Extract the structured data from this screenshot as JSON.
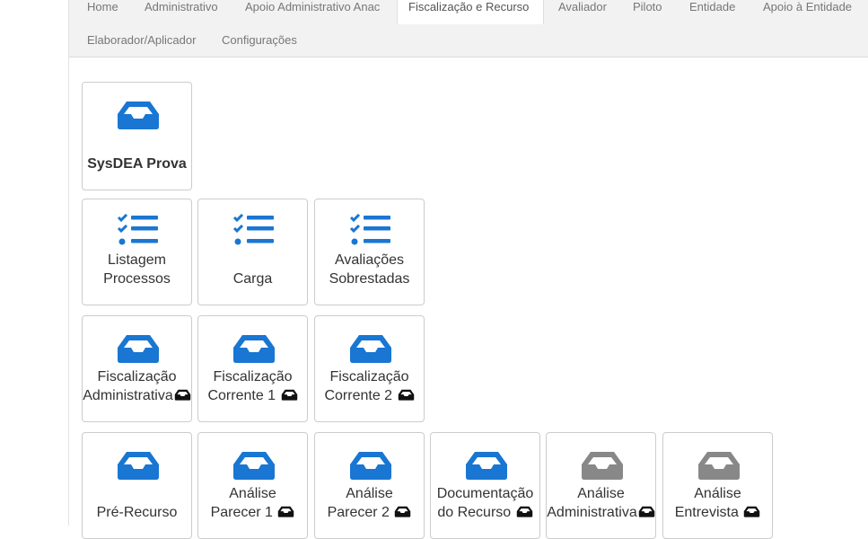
{
  "nav": {
    "items": [
      "Home",
      "Administrativo",
      "Apoio Administrativo Anac",
      "Fiscalização e Recurso",
      "Avaliador",
      "Piloto",
      "Entidade",
      "Apoio à Entidade",
      "Elaborador/Aplicador",
      "Configurações"
    ],
    "active": "Fiscalização e Recurso"
  },
  "icons": {
    "inbox": "inbox-icon",
    "list": "list-check-icon",
    "inbox_small": "inbox-small-icon"
  },
  "colors": {
    "brand_blue": "#1976d2",
    "disabled_gray": "#888888",
    "icon_black": "#111111"
  },
  "tiles": {
    "row1": [
      {
        "line1": "",
        "line2": "SysDEA Prova"
      }
    ],
    "row2": [
      {
        "line1": "Listagem",
        "line2": "Processos"
      },
      {
        "line1": "",
        "line2": "Carga"
      },
      {
        "line1": "Avaliações",
        "line2": "Sobrestadas"
      }
    ],
    "row3": [
      {
        "line1": "Fiscalização",
        "line2": "Administrativa"
      },
      {
        "line1": "Fiscalização",
        "line2": "Corrente 1"
      },
      {
        "line1": "Fiscalização",
        "line2": "Corrente 2"
      }
    ],
    "row4": [
      {
        "line1": "",
        "line2": "Pré-Recurso"
      },
      {
        "line1": "Análise",
        "line2": "Parecer 1"
      },
      {
        "line1": "Análise",
        "line2": "Parecer 2"
      },
      {
        "line1": "Documentação",
        "line2": "do Recurso"
      },
      {
        "line1": "Análise",
        "line2": "Administrativa"
      },
      {
        "line1": "Análise",
        "line2": "Entrevista"
      }
    ]
  }
}
